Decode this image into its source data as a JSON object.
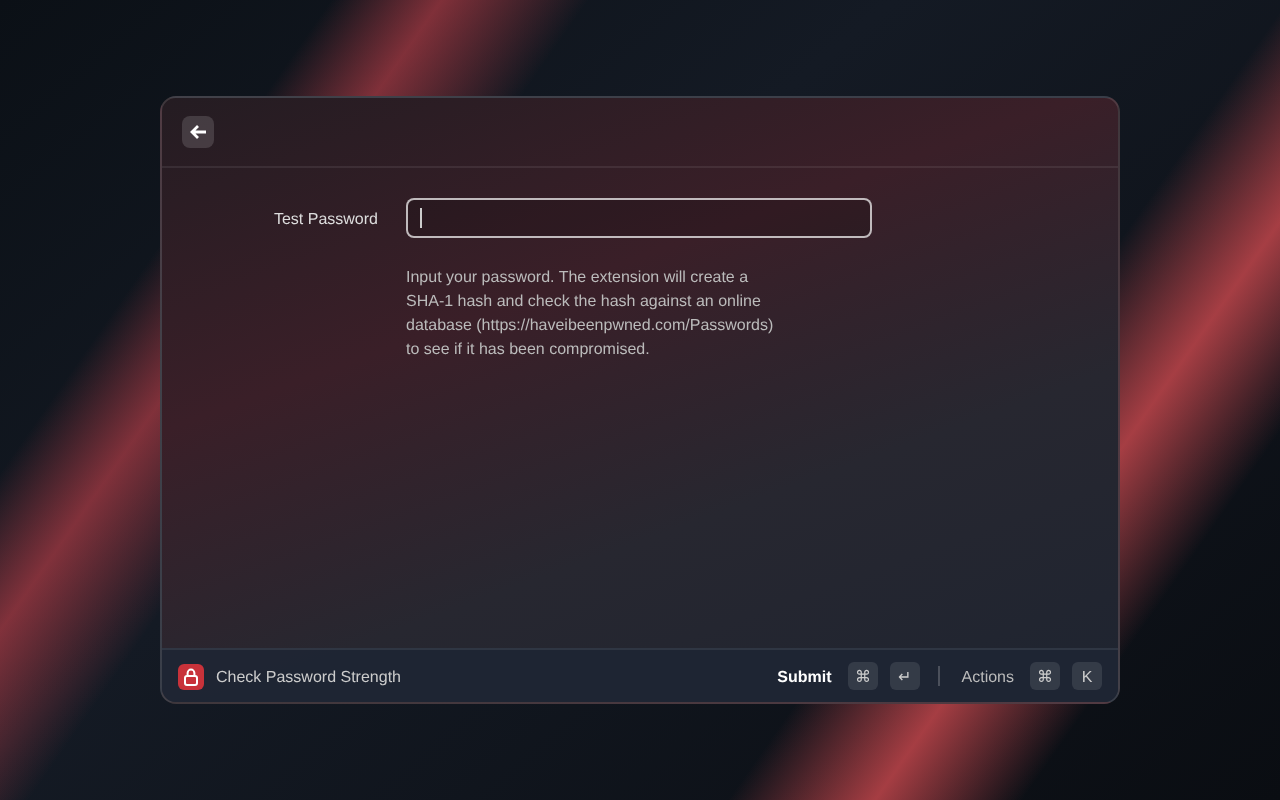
{
  "form": {
    "label": "Test Password",
    "field": {
      "focused": true
    },
    "description": "Input your password. The extension will create a SHA-1 hash and check the hash against an online database (https://haveibeenpwned.com/Passwords) to see if it has been compromised."
  },
  "footer": {
    "command": "Check Password Strength",
    "actions": [
      {
        "label": "Submit",
        "primary": true,
        "keys": [
          "⌘",
          "↵"
        ]
      },
      {
        "label": "Actions",
        "primary": false,
        "keys": [
          "⌘",
          "K"
        ]
      }
    ]
  }
}
